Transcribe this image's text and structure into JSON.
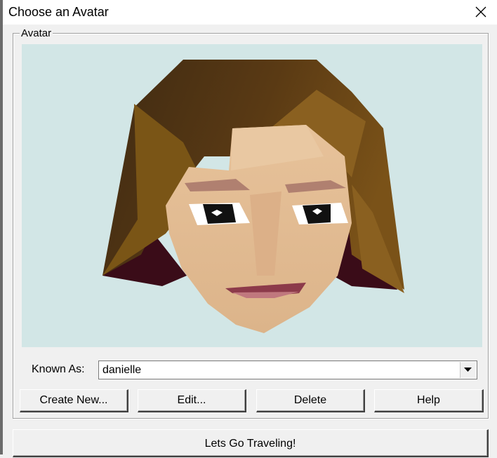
{
  "window": {
    "title": "Choose an Avatar"
  },
  "icons": {
    "close": "close-icon",
    "dropdown": "chevron-down-icon"
  },
  "avatar": {
    "group_label": "Avatar",
    "background_color": "#d2e6e6",
    "known_as_label": "Known As:",
    "known_as_value": "danielle"
  },
  "buttons": {
    "create_new": "Create New...",
    "edit": "Edit...",
    "delete": "Delete",
    "help": "Help",
    "go": "Lets Go Traveling!"
  }
}
